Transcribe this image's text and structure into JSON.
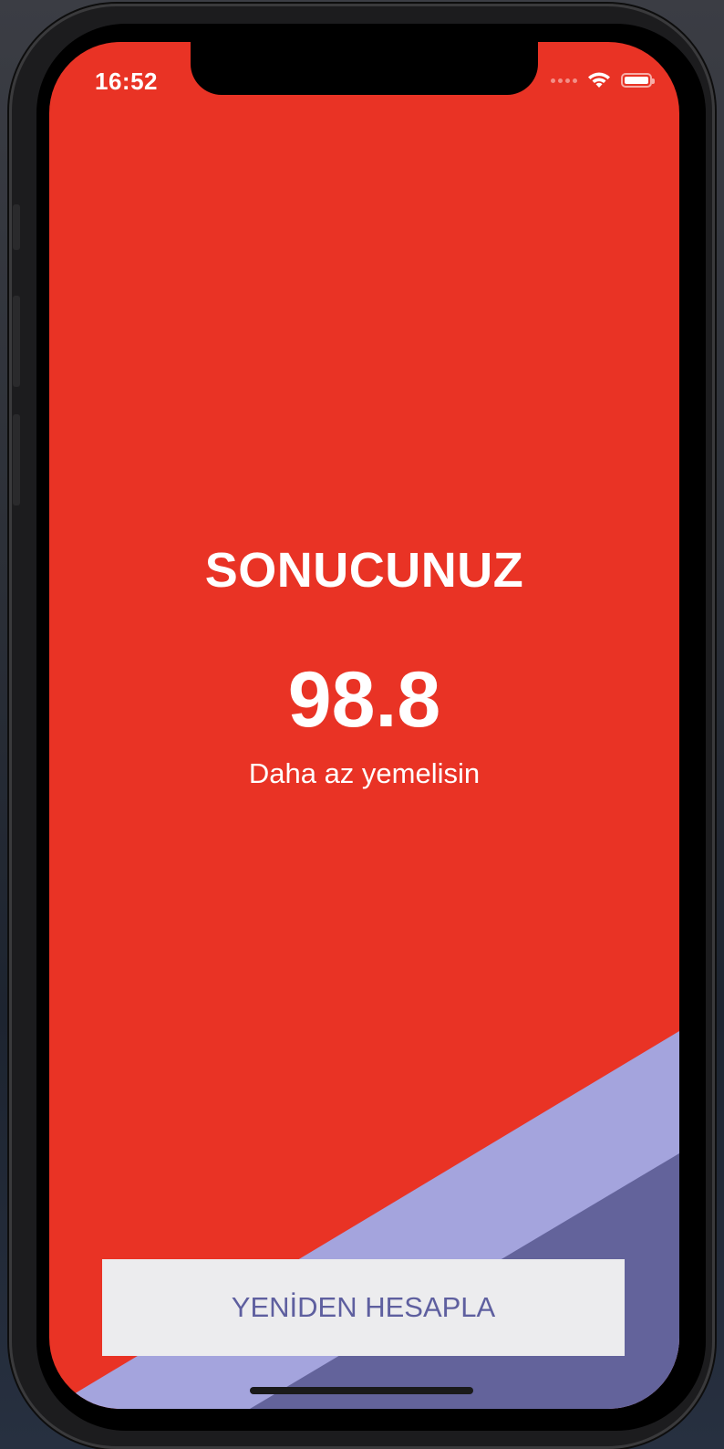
{
  "status_bar": {
    "time": "16:52",
    "icons": [
      "signal-dots-icon",
      "wifi-icon",
      "battery-icon"
    ]
  },
  "result": {
    "title": "SONUCUNUZ",
    "value": "98.8",
    "message": "Daha az yemelisin"
  },
  "actions": {
    "recalculate_label": "YENİDEN HESAPLA"
  },
  "colors": {
    "background": "#e93325",
    "wave_light": "#a4a4dd",
    "wave_dark": "#63639b",
    "button_bg": "#ececee",
    "button_text": "#5e5f9f",
    "text": "#ffffff"
  }
}
